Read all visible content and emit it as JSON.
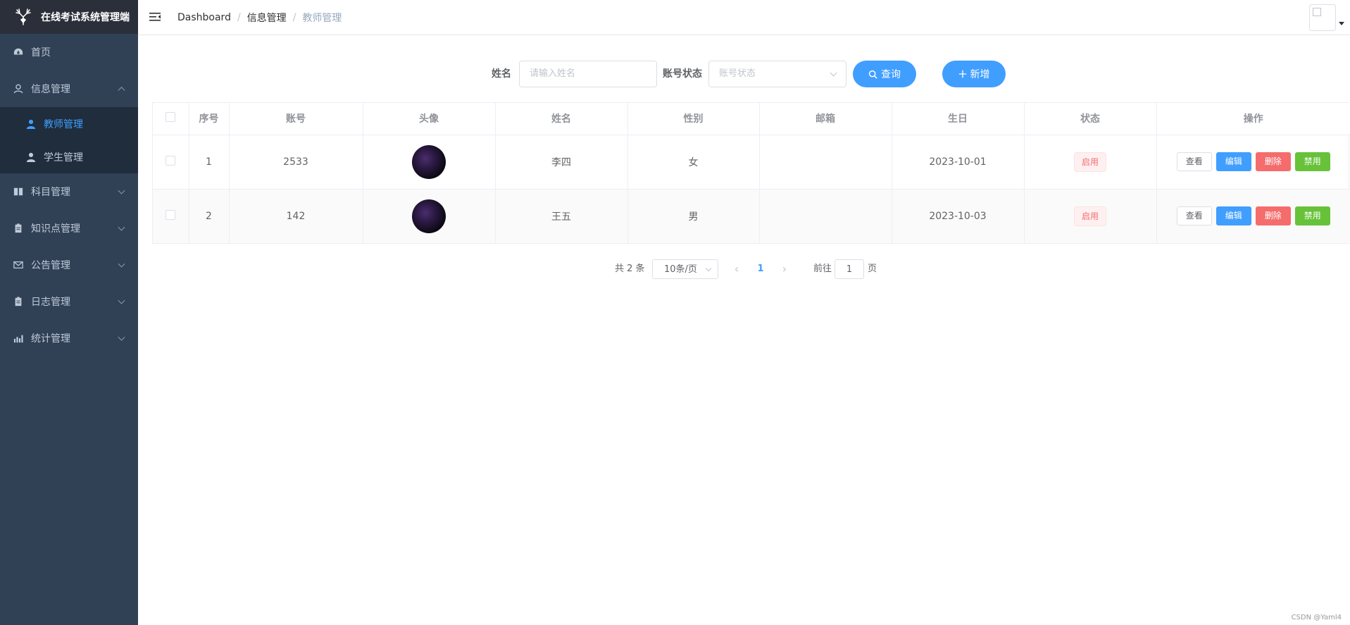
{
  "app": {
    "title": "在线考试系统管理端"
  },
  "sidebar": {
    "items": [
      {
        "label": "首页",
        "icon": "dashboard-icon"
      },
      {
        "label": "信息管理",
        "icon": "user-icon",
        "expanded": true,
        "children": [
          {
            "label": "教师管理",
            "icon": "person-icon",
            "active": true
          },
          {
            "label": "学生管理",
            "icon": "person-icon"
          }
        ]
      },
      {
        "label": "科目管理",
        "icon": "book-icon"
      },
      {
        "label": "知识点管理",
        "icon": "clipboard-icon"
      },
      {
        "label": "公告管理",
        "icon": "mail-icon"
      },
      {
        "label": "日志管理",
        "icon": "clipboard-icon"
      },
      {
        "label": "统计管理",
        "icon": "chart-icon"
      }
    ]
  },
  "breadcrumb": [
    "Dashboard",
    "信息管理",
    "教师管理"
  ],
  "search": {
    "name_label": "姓名",
    "name_placeholder": "请输入姓名",
    "status_label": "账号状态",
    "status_placeholder": "账号状态",
    "query_button": "查询",
    "add_button": "新增"
  },
  "table": {
    "columns": [
      "序号",
      "账号",
      "头像",
      "姓名",
      "性别",
      "邮箱",
      "生日",
      "状态",
      "操作"
    ],
    "rows": [
      {
        "index": "1",
        "account": "2533",
        "name": "李四",
        "gender": "女",
        "email": "",
        "birthday": "2023-10-01",
        "status": "启用"
      },
      {
        "index": "2",
        "account": "142",
        "name": "王五",
        "gender": "男",
        "email": "",
        "birthday": "2023-10-03",
        "status": "启用"
      }
    ],
    "actions": {
      "view": "查看",
      "edit": "编辑",
      "delete": "删除",
      "disable": "禁用"
    }
  },
  "pagination": {
    "total": "共 2 条",
    "page_size": "10条/页",
    "current_page": "1",
    "goto_label": "前往",
    "goto_value": "1",
    "page_suffix": "页"
  },
  "watermark": "CSDN @Yaml4",
  "colors": {
    "sidebar_bg": "#304156",
    "logo_bg": "#2b2f3a",
    "accent": "#409eff",
    "danger": "#f56c6c",
    "success": "#67c23a"
  }
}
